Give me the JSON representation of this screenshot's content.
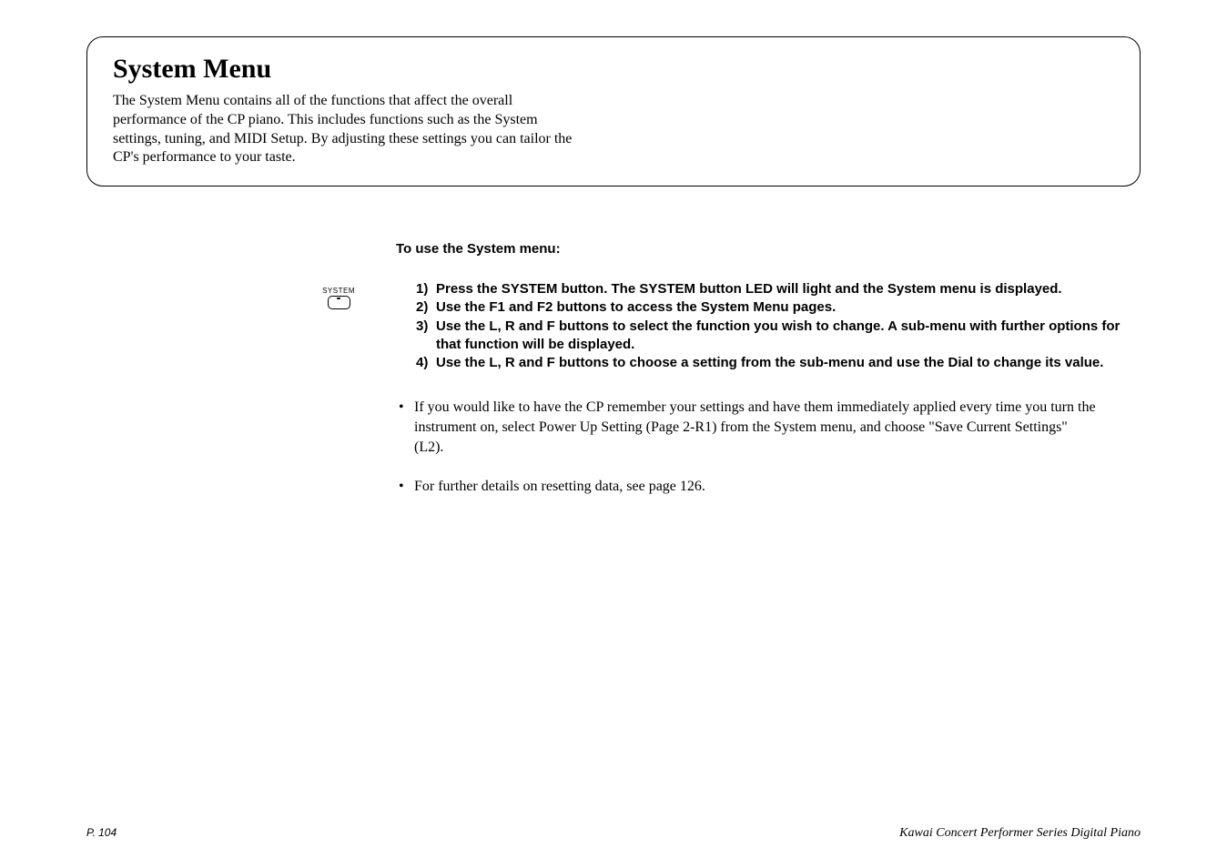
{
  "header": {
    "title": "System Menu",
    "description": "The System Menu contains all of the functions that affect the overall performance of the CP piano.  This includes functions such as the System settings, tuning, and MIDI Setup.  By adjusting these settings you can tailor the CP's performance to your taste."
  },
  "button": {
    "label": "SYSTEM"
  },
  "content": {
    "section_heading": "To use the System menu:",
    "steps": [
      {
        "n": "1)",
        "text": "Press the SYSTEM button.  The SYSTEM button LED will light and the System menu is displayed."
      },
      {
        "n": "2)",
        "text": "Use the F1 and F2 buttons to access the System Menu pages."
      },
      {
        "n": "3)",
        "text": "Use the L, R and F buttons to select the function you wish to change.  A sub-menu with further options for that function will be displayed."
      },
      {
        "n": "4)",
        "text": "Use the L, R and F buttons to choose a setting from the sub-menu and use the Dial to change its value."
      }
    ],
    "bullets": [
      "If you would like to have the CP remember your settings and have them immediately applied every time you turn the instrument on, select Power Up Setting (Page 2-R1) from the System menu, and choose \"Save Current Settings\" (L2).",
      "For further details on resetting data, see page 126."
    ]
  },
  "footer": {
    "page": "P. 104",
    "right": "Kawai Concert Performer Series Digital Piano"
  }
}
